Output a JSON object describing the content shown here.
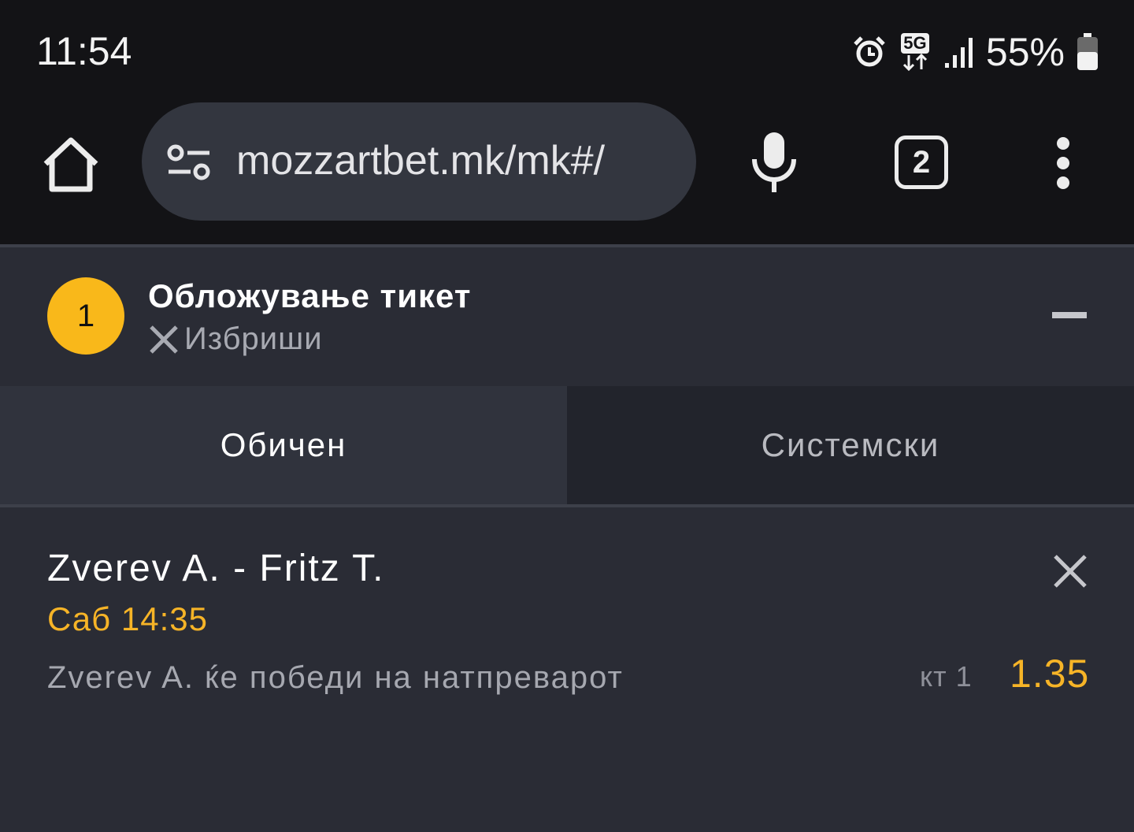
{
  "status_bar": {
    "time": "11:54",
    "network_label": "5G",
    "battery_percent": "55%",
    "icons": [
      "alarm-icon",
      "5g-data-icon",
      "signal-icon",
      "battery-icon"
    ]
  },
  "browser": {
    "url": "mozzartbet.mk/mk#/",
    "tab_count": "2",
    "icons": [
      "home-icon",
      "site-settings-icon",
      "mic-icon",
      "tab-switcher-icon",
      "overflow-menu-icon"
    ]
  },
  "ticket": {
    "count": "1",
    "title": "Обложување тикет",
    "delete_label": "Избриши"
  },
  "ticket_types": {
    "regular": "Обичен",
    "system": "Системски",
    "active": "regular"
  },
  "selection": {
    "match": "Zverev A. - Fritz T.",
    "time": "Саб 14:35",
    "pick": "Zverev A. ќе победи на натпреварот",
    "odds_label": "кт 1",
    "odds": "1.35"
  },
  "colors": {
    "accent": "#f9b81a",
    "odds": "#f6b427",
    "background": "#2a2c35",
    "browser_chrome": "#131316"
  }
}
